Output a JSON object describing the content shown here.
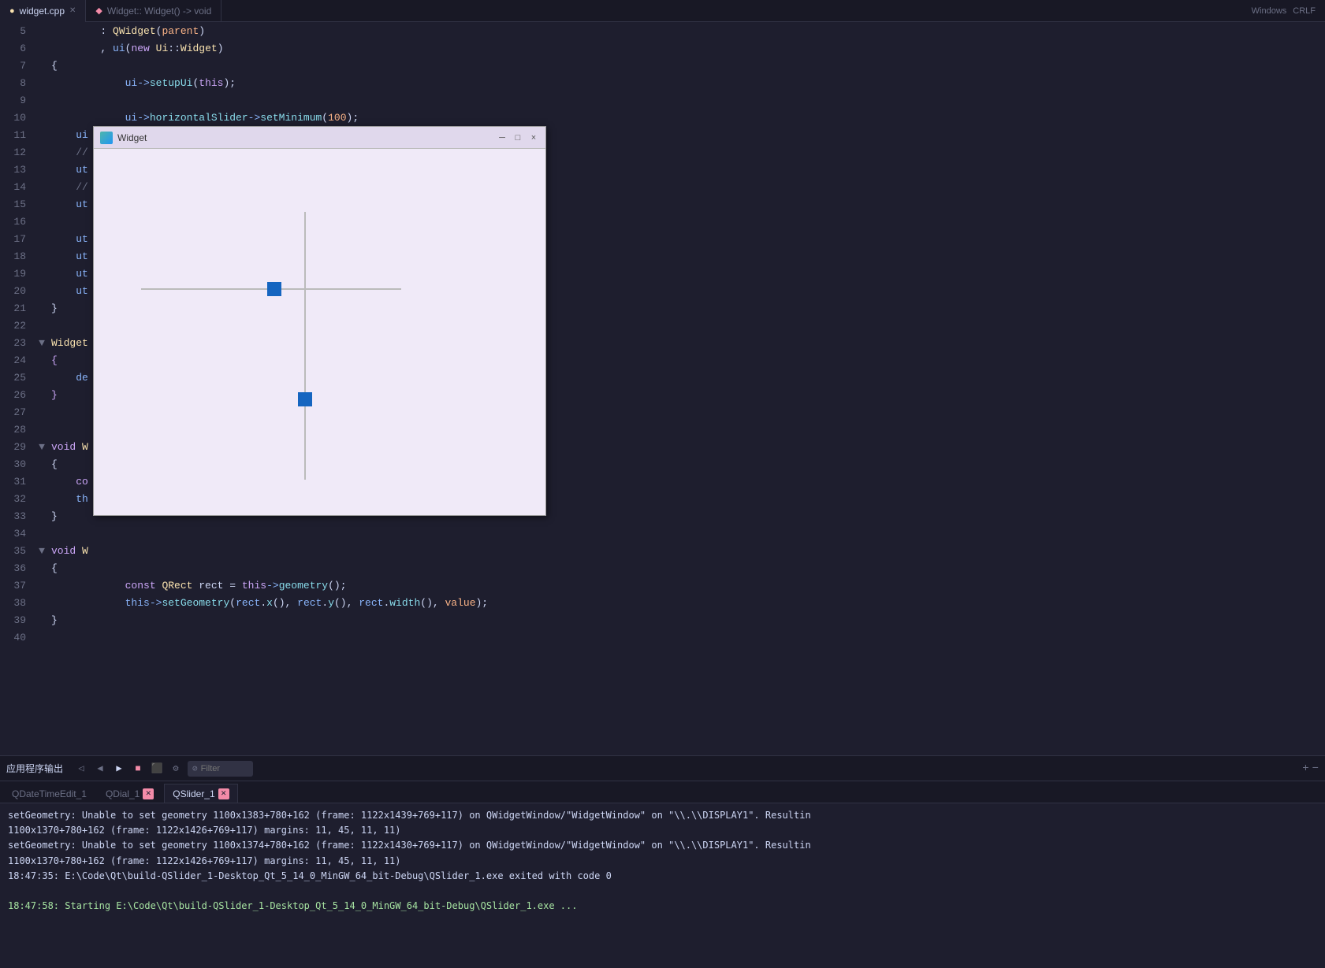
{
  "tabs": [
    {
      "label": "widget.cpp",
      "active": true,
      "modified": false
    },
    {
      "label": "Widget:: Widget() -> void",
      "active": false
    }
  ],
  "breadcrumb": {
    "file": "widget.cpp",
    "fn": "Widget:: Widget() -> void",
    "platform": "Windows",
    "line_ending": "CRLF"
  },
  "widget_window": {
    "title": "Widget",
    "minimize": "─",
    "maximize": "□",
    "close": "×"
  },
  "code_lines": [
    {
      "num": "5",
      "indent": 2,
      "fold": "",
      "text": ": QWidget(parent)"
    },
    {
      "num": "6",
      "indent": 2,
      "fold": "",
      "text": ", ui(new Ui::Widget)"
    },
    {
      "num": "7",
      "indent": 0,
      "fold": "",
      "text": "{"
    },
    {
      "num": "8",
      "indent": 1,
      "fold": "",
      "text": "    ui->setupUi(this);"
    },
    {
      "num": "9",
      "indent": 0,
      "fold": "",
      "text": ""
    },
    {
      "num": "10",
      "indent": 1,
      "fold": "",
      "text": "    ui->horizontalSlider->setMinimum(100);"
    },
    {
      "num": "11",
      "indent": 1,
      "fold": "",
      "text": "    ui"
    },
    {
      "num": "12",
      "indent": 1,
      "fold": "",
      "text": "    //"
    },
    {
      "num": "13",
      "indent": 1,
      "fold": "",
      "text": "    ut"
    },
    {
      "num": "14",
      "indent": 1,
      "fold": "",
      "text": "    //"
    },
    {
      "num": "15",
      "indent": 1,
      "fold": "",
      "text": "    ut"
    },
    {
      "num": "16",
      "indent": 0,
      "fold": "",
      "text": ""
    },
    {
      "num": "17",
      "indent": 1,
      "fold": "",
      "text": "    ut"
    },
    {
      "num": "18",
      "indent": 1,
      "fold": "",
      "text": "    ut"
    },
    {
      "num": "19",
      "indent": 1,
      "fold": "",
      "text": "    ut"
    },
    {
      "num": "20",
      "indent": 1,
      "fold": "",
      "text": "    ut"
    },
    {
      "num": "21",
      "indent": 0,
      "fold": "",
      "text": "}"
    },
    {
      "num": "22",
      "indent": 0,
      "fold": "",
      "text": ""
    },
    {
      "num": "23",
      "indent": 0,
      "fold": "▼",
      "text": "Widget"
    },
    {
      "num": "24",
      "indent": 0,
      "fold": "",
      "text": "{"
    },
    {
      "num": "25",
      "indent": 1,
      "fold": "",
      "text": "    de"
    },
    {
      "num": "26",
      "indent": 0,
      "fold": "",
      "text": "}"
    },
    {
      "num": "27",
      "indent": 0,
      "fold": "",
      "text": ""
    },
    {
      "num": "28",
      "indent": 0,
      "fold": "",
      "text": ""
    },
    {
      "num": "29",
      "indent": 0,
      "fold": "▼",
      "text": "void W"
    },
    {
      "num": "30",
      "indent": 0,
      "fold": "",
      "text": "{"
    },
    {
      "num": "31",
      "indent": 1,
      "fold": "",
      "text": "    co"
    },
    {
      "num": "32",
      "indent": 1,
      "fold": "",
      "text": "    th"
    },
    {
      "num": "33",
      "indent": 0,
      "fold": "",
      "text": "}"
    },
    {
      "num": "34",
      "indent": 0,
      "fold": "",
      "text": ""
    },
    {
      "num": "35",
      "indent": 0,
      "fold": "▼",
      "text": "void W"
    },
    {
      "num": "36",
      "indent": 0,
      "fold": "",
      "text": "{"
    },
    {
      "num": "37",
      "indent": 1,
      "fold": "",
      "text": "    const QRect rect = this->geometry();"
    },
    {
      "num": "38",
      "indent": 1,
      "fold": "",
      "text": "    this->setGeometry(rect.x(), rect.y(), rect.width(), value);"
    },
    {
      "num": "39",
      "indent": 0,
      "fold": "",
      "text": "}"
    },
    {
      "num": "40",
      "indent": 0,
      "fold": "",
      "text": ""
    }
  ],
  "bottom_panel": {
    "title": "应用程序输出",
    "filter_placeholder": "Filter",
    "plus": "+",
    "minus": "−"
  },
  "panel_tabs": [
    {
      "label": "QDateTimeEdit_1",
      "active": false,
      "has_close": false
    },
    {
      "label": "QDial_1",
      "active": false,
      "has_close": false
    },
    {
      "label": "QSlider_1",
      "active": true,
      "has_close": true
    }
  ],
  "output_lines": [
    {
      "text": "setGeometry: Unable to set geometry 1100x1383+780+162 (frame: 1122x1439+769+117) on QWidgetWindow/\"WidgetWindow\" on \"\\\\.\\DISPLAY1\". Resultin",
      "highlight": false
    },
    {
      "text": "1100x1370+780+162 (frame: 1122x1426+769+117) margins: 11, 45, 11, 11)",
      "highlight": false
    },
    {
      "text": "setGeometry: Unable to set geometry 1100x1374+780+162 (frame: 1122x1430+769+117) on QWidgetWindow/\"WidgetWindow\" on \"\\\\.\\DISPLAY1\". Resultin",
      "highlight": false
    },
    {
      "text": "1100x1370+780+162 (frame: 1122x1426+769+117) margins: 11, 45, 11, 11)",
      "highlight": false
    },
    {
      "text": "18:47:35: E:\\Code\\Qt\\build-QSlider_1-Desktop_Qt_5_14_0_MinGW_64_bit-Debug\\QSlider_1.exe exited with code 0",
      "highlight": false
    },
    {
      "text": "",
      "highlight": false
    },
    {
      "text": "18:47:58: Starting E:\\Code\\Qt\\build-QSlider_1-Desktop_Qt_5_14_0_MinGW_64_bit-Debug\\QSlider_1.exe ...",
      "highlight": true
    }
  ],
  "colors": {
    "bg": "#1e1e2e",
    "bg2": "#181825",
    "accent": "#89b4fa",
    "green": "#a6e3a1",
    "red": "#f38ba8",
    "yellow": "#f9e2af",
    "purple": "#cba6f7",
    "surface": "#313244"
  }
}
